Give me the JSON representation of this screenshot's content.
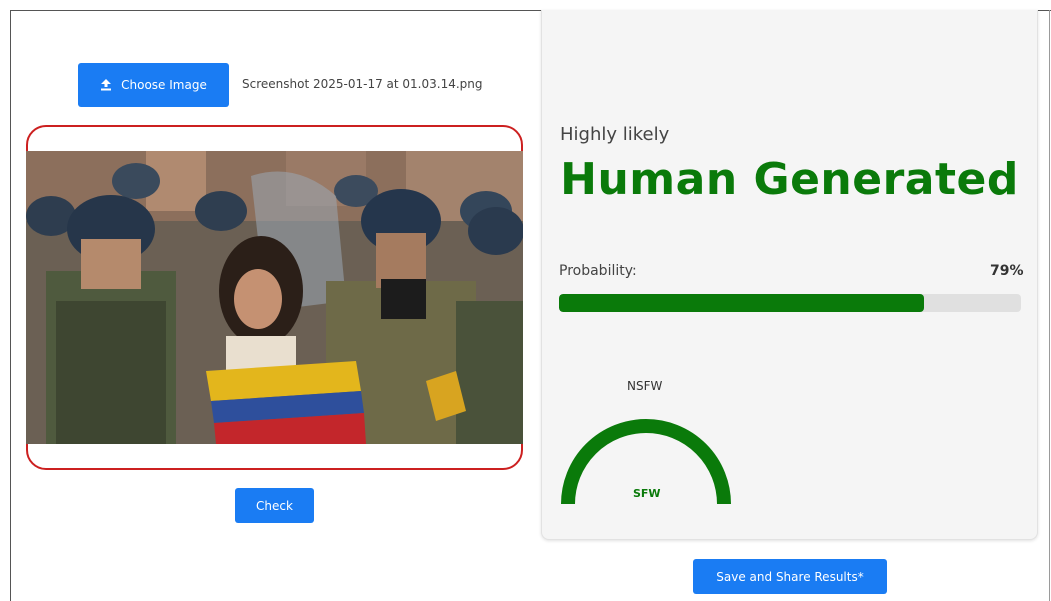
{
  "upload": {
    "button_label": "Choose Image",
    "file_name": "Screenshot 2025-01-17 at 01.03.14.png"
  },
  "preview": {
    "alt": "Uploaded photo: riot police in helmets escorting a young woman wrapped in a yellow, blue and red flag"
  },
  "actions": {
    "check_label": "Check",
    "share_label": "Save and Share Results*"
  },
  "result": {
    "likelihood": "Highly likely",
    "verdict": "Human Generated",
    "probability_label": "Probability:",
    "probability_text": "79%",
    "probability_fraction": 0.79
  },
  "gauge": {
    "top_label": "NSFW",
    "bottom_label": "SFW",
    "level_fraction": 0.0
  },
  "colors": {
    "accent_blue": "#1a7cf3",
    "verdict_green": "#0a7a0a",
    "frame_red": "#cc2020",
    "track_gray": "#e0e0e0"
  }
}
